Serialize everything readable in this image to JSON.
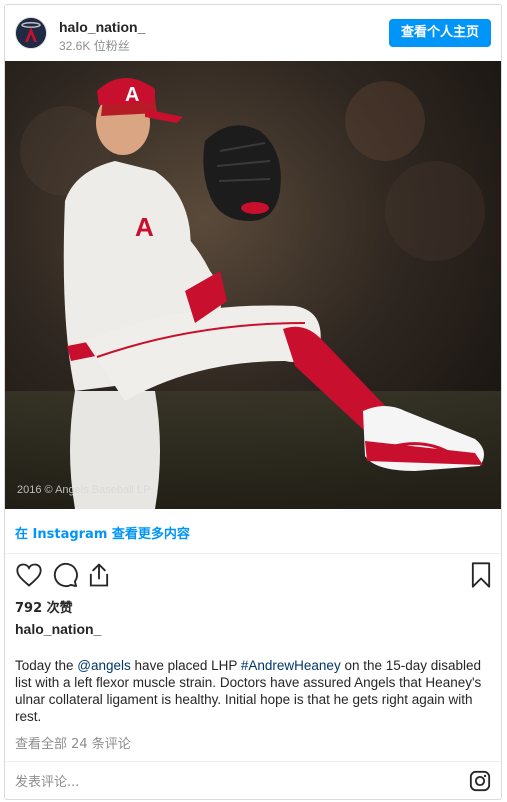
{
  "header": {
    "username": "halo_nation_",
    "followers": "32.6K 位粉丝",
    "profile_button": "查看个人主页"
  },
  "photo": {
    "watermark": "2016 © Angels Baseball LP",
    "cap_letter": "A"
  },
  "view_more": "在 Instagram 查看更多内容",
  "likes": "792 次赞",
  "caption": {
    "user": "halo_nation_",
    "text_1": "Today the ",
    "mention": "@angels",
    "text_2": " have placed LHP ",
    "hashtag": "#AndrewHeaney",
    "text_3": " on the 15-day disabled list with a left flexor muscle strain. Doctors have assured Angels that Heaney's ulnar collateral ligament is healthy. Initial hope is that he gets right again with rest."
  },
  "all_comments": "查看全部 24 条评论",
  "comment": {
    "placeholder": "发表评论..."
  },
  "colors": {
    "accent": "#0095f6",
    "link": "#00376b",
    "uniform_red": "#c8102e"
  },
  "icons": [
    "heart-icon",
    "comment-icon",
    "share-icon",
    "bookmark-icon",
    "instagram-icon"
  ]
}
